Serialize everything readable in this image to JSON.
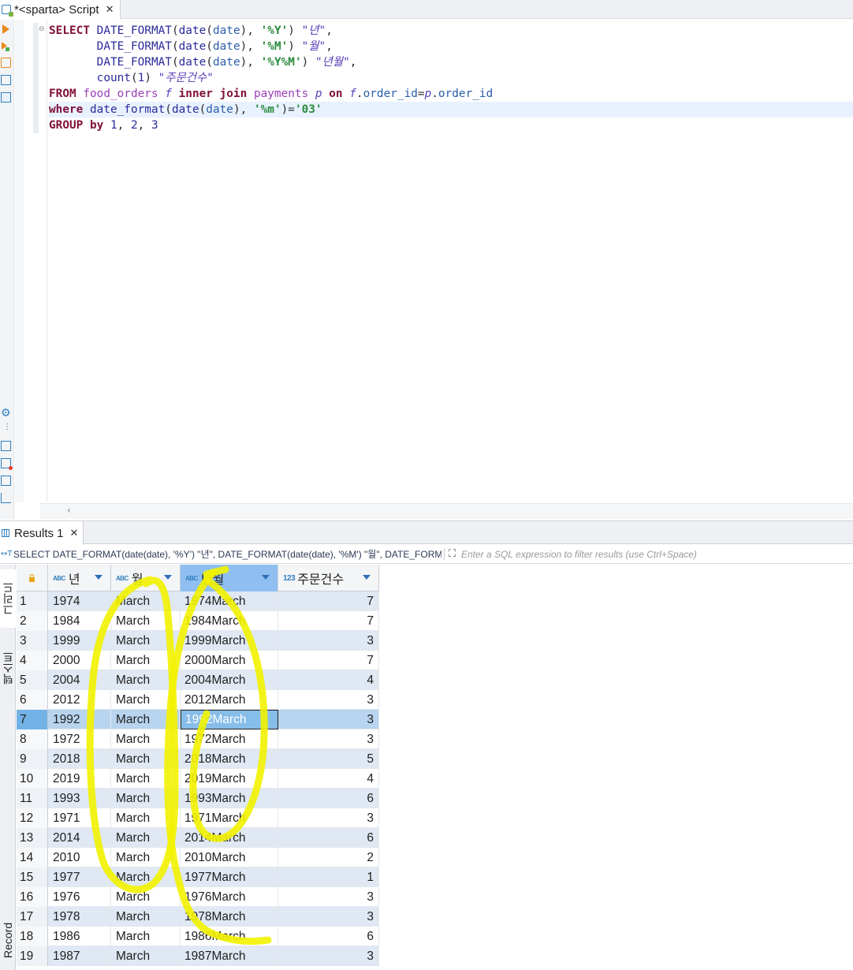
{
  "editor_tab": {
    "title": "*<sparta> Script",
    "close": "✕"
  },
  "sql_lines": [
    [
      [
        "kw",
        "SELECT "
      ],
      [
        "fn",
        "DATE_FORMAT"
      ],
      [
        "punct",
        "("
      ],
      [
        "fn",
        "date"
      ],
      [
        "punct",
        "("
      ],
      [
        "col",
        "date"
      ],
      [
        "punct",
        "), "
      ],
      [
        "str",
        "'%Y'"
      ],
      [
        "punct",
        ") "
      ],
      [
        "alias",
        "\"년\""
      ],
      [
        "punct",
        ","
      ]
    ],
    [
      [
        "punct",
        "       "
      ],
      [
        "fn",
        "DATE_FORMAT"
      ],
      [
        "punct",
        "("
      ],
      [
        "fn",
        "date"
      ],
      [
        "punct",
        "("
      ],
      [
        "col",
        "date"
      ],
      [
        "punct",
        "), "
      ],
      [
        "str",
        "'%M'"
      ],
      [
        "punct",
        ") "
      ],
      [
        "alias",
        "\"월\""
      ],
      [
        "punct",
        ","
      ]
    ],
    [
      [
        "punct",
        "       "
      ],
      [
        "fn",
        "DATE_FORMAT"
      ],
      [
        "punct",
        "("
      ],
      [
        "fn",
        "date"
      ],
      [
        "punct",
        "("
      ],
      [
        "col",
        "date"
      ],
      [
        "punct",
        "), "
      ],
      [
        "str",
        "'%Y%M'"
      ],
      [
        "punct",
        ") "
      ],
      [
        "alias",
        "\"년월\""
      ],
      [
        "punct",
        ","
      ]
    ],
    [
      [
        "punct",
        "       "
      ],
      [
        "fn",
        "count"
      ],
      [
        "punct",
        "("
      ],
      [
        "num",
        "1"
      ],
      [
        "punct",
        ") "
      ],
      [
        "alias",
        "\"주문건수\""
      ]
    ],
    [
      [
        "kw",
        "FROM "
      ],
      [
        "tbl",
        "food_orders "
      ],
      [
        "alias",
        "f "
      ],
      [
        "kw",
        "inner join "
      ],
      [
        "tbl",
        "payments "
      ],
      [
        "alias",
        "p "
      ],
      [
        "kw",
        "on "
      ],
      [
        "alias",
        "f"
      ],
      [
        "punct",
        "."
      ],
      [
        "col",
        "order_id"
      ],
      [
        "punct",
        "="
      ],
      [
        "alias",
        "p"
      ],
      [
        "punct",
        "."
      ],
      [
        "col",
        "order_id"
      ]
    ],
    [
      [
        "kw",
        "where "
      ],
      [
        "fn",
        "date_format"
      ],
      [
        "punct",
        "("
      ],
      [
        "fn",
        "date"
      ],
      [
        "punct",
        "("
      ],
      [
        "col",
        "date"
      ],
      [
        "punct",
        "), "
      ],
      [
        "str",
        "'%m'"
      ],
      [
        "punct",
        ")="
      ],
      [
        "str",
        "'03'"
      ]
    ],
    [
      [
        "kw",
        "GROUP by "
      ],
      [
        "num",
        "1"
      ],
      [
        "punct",
        ", "
      ],
      [
        "num",
        "2"
      ],
      [
        "punct",
        ", "
      ],
      [
        "num",
        "3"
      ]
    ]
  ],
  "results_tab": {
    "title": "Results 1",
    "close": "✕"
  },
  "filter_bar": {
    "query_icon": "↔T",
    "query_text": "SELECT DATE_FORMAT(date(date), '%Y') \"년\", DATE_FORMAT(date(date), '%M') \"월\", DATE_FORMAT",
    "placeholder": "Enter a SQL expression to filter results (use Ctrl+Space)"
  },
  "vertical_tabs": {
    "grid": "그리드",
    "text": "텍스트",
    "record": "Record"
  },
  "columns": [
    {
      "type": "ABC",
      "name": "년"
    },
    {
      "type": "ABC",
      "name": "월"
    },
    {
      "type": "ABC",
      "name": "년월"
    },
    {
      "type": "123",
      "name": "주문건수"
    }
  ],
  "rows": [
    {
      "n": "1",
      "year": "1974",
      "month": "March",
      "ym": "1974March",
      "count": "7"
    },
    {
      "n": "2",
      "year": "1984",
      "month": "March",
      "ym": "1984March",
      "count": "7"
    },
    {
      "n": "3",
      "year": "1999",
      "month": "March",
      "ym": "1999March",
      "count": "3"
    },
    {
      "n": "4",
      "year": "2000",
      "month": "March",
      "ym": "2000March",
      "count": "7"
    },
    {
      "n": "5",
      "year": "2004",
      "month": "March",
      "ym": "2004March",
      "count": "4"
    },
    {
      "n": "6",
      "year": "2012",
      "month": "March",
      "ym": "2012March",
      "count": "3"
    },
    {
      "n": "7",
      "year": "1992",
      "month": "March",
      "ym": "1992March",
      "count": "3"
    },
    {
      "n": "8",
      "year": "1972",
      "month": "March",
      "ym": "1972March",
      "count": "3"
    },
    {
      "n": "9",
      "year": "2018",
      "month": "March",
      "ym": "2018March",
      "count": "5"
    },
    {
      "n": "10",
      "year": "2019",
      "month": "March",
      "ym": "2019March",
      "count": "4"
    },
    {
      "n": "11",
      "year": "1993",
      "month": "March",
      "ym": "1993March",
      "count": "6"
    },
    {
      "n": "12",
      "year": "1971",
      "month": "March",
      "ym": "1971March",
      "count": "3"
    },
    {
      "n": "13",
      "year": "2014",
      "month": "March",
      "ym": "2014March",
      "count": "6"
    },
    {
      "n": "14",
      "year": "2010",
      "month": "March",
      "ym": "2010March",
      "count": "2"
    },
    {
      "n": "15",
      "year": "1977",
      "month": "March",
      "ym": "1977March",
      "count": "1"
    },
    {
      "n": "16",
      "year": "1976",
      "month": "March",
      "ym": "1976March",
      "count": "3"
    },
    {
      "n": "17",
      "year": "1978",
      "month": "March",
      "ym": "1978March",
      "count": "3"
    },
    {
      "n": "18",
      "year": "1986",
      "month": "March",
      "ym": "1986March",
      "count": "6"
    },
    {
      "n": "19",
      "year": "1987",
      "month": "March",
      "ym": "1987March",
      "count": "3"
    }
  ],
  "selected_row": "7",
  "highlight_color": "#f2f200"
}
